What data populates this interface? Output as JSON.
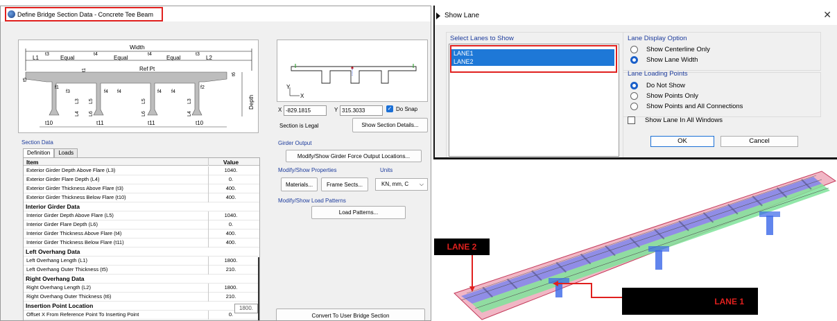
{
  "bridge_dialog": {
    "title": "Define Bridge Section Data - Concrete Tee Beam",
    "diagram": {
      "width": "Width",
      "l1": "L1",
      "l2": "L2",
      "t3a": "t3",
      "t3b": "t3",
      "t4a": "t4",
      "t4b": "t4",
      "equal1": "Equal",
      "equal2": "Equal",
      "equal3": "Equal",
      "t5": "t5",
      "t1": "t1",
      "t6": "t6",
      "ref_pt": "Ref Pt",
      "f1": "f1",
      "f2": "f2",
      "f3": "f3",
      "f4a": "f4",
      "f4b": "f4",
      "f4c": "f4",
      "f4d": "f4",
      "l3a": "L3",
      "l3b": "L3",
      "l4a": "L4",
      "l4b": "L4",
      "l5a": "L5",
      "l5b": "L5",
      "l6a": "L6",
      "l6b": "L6",
      "depth": "Depth",
      "t10a": "t10",
      "t10b": "t10",
      "t11a": "t11",
      "t11b": "t11"
    },
    "preview": {
      "axis_y": "Y",
      "axis_x": "X"
    },
    "coords": {
      "x_label": "X",
      "x_value": "-829.1815",
      "y_label": "Y",
      "y_value": "315.3033",
      "snap_label": "Do Snap"
    },
    "section_status": "Section is Legal",
    "show_details_button": "Show Section Details...",
    "section_data_label": "Section Data",
    "tabs": [
      "Definition",
      "Loads"
    ],
    "grid_headers": {
      "item": "Item",
      "value": "Value"
    },
    "rows": [
      {
        "item": "Exterior Girder Depth Above Flare (L3)",
        "value": "1040."
      },
      {
        "item": "Exterior Girder Flare Depth (L4)",
        "value": "0."
      },
      {
        "item": "Exterior Girder Thickness Above Flare (t3)",
        "value": "400."
      },
      {
        "item": "Exterior Girder Thickness Below Flare (t10)",
        "value": "400."
      },
      {
        "item": "Interior Girder Data",
        "value": ""
      },
      {
        "item": "Interior Girder Depth Above Flare (L5)",
        "value": "1040."
      },
      {
        "item": "Interior Girder Flare Depth (L6)",
        "value": "0."
      },
      {
        "item": "Interior Girder Thickness Above Flare (t4)",
        "value": "400."
      },
      {
        "item": "Interior Girder Thickness Below Flare (t11)",
        "value": "400."
      },
      {
        "item": "Left Overhang Data",
        "value": ""
      },
      {
        "item": "Left Overhang Length (L1)",
        "value": "1800."
      },
      {
        "item": "Left Overhang Outer Thickness (t5)",
        "value": "210."
      },
      {
        "item": "Right Overhang Data",
        "value": ""
      },
      {
        "item": "Right Overhang Length (L2)",
        "value": "1800."
      },
      {
        "item": "Right Overhang Outer Thickness (t6)",
        "value": "210."
      },
      {
        "item": "Insertion Point Location",
        "value": ""
      },
      {
        "item": "Offset X From Reference Point To Inserting Point",
        "value": "0."
      }
    ],
    "tooltip_value": "1800.",
    "girder_output": {
      "label": "Girder Output",
      "button": "Modify/Show Girder Force Output Locations..."
    },
    "properties": {
      "label": "Modify/Show Properties",
      "materials": "Materials...",
      "frame_sects": "Frame Sects..."
    },
    "units": {
      "label": "Units",
      "value": "KN, mm, C"
    },
    "load_patterns": {
      "label": "Modify/Show Load Patterns",
      "button": "Load Patterns..."
    },
    "convert_button": "Convert To User Bridge Section"
  },
  "lane_dialog": {
    "title": "Show Lane",
    "select_label": "Select Lanes to Show",
    "lanes": [
      "LANE1",
      "LANE2"
    ],
    "display_label": "Lane Display Option",
    "display_options": [
      {
        "label": "Show Centerline Only",
        "selected": false
      },
      {
        "label": "Show Lane Width",
        "selected": true
      }
    ],
    "loading_label": "Lane Loading Points",
    "loading_options": [
      {
        "label": "Do Not Show",
        "selected": true
      },
      {
        "label": "Show Points Only",
        "selected": false
      },
      {
        "label": "Show Points and All Connections",
        "selected": false
      }
    ],
    "show_all_windows": "Show Lane In All Windows",
    "ok": "OK",
    "cancel": "Cancel"
  },
  "view3d": {
    "lane2_tag": "LANE 2",
    "lane1_tag": "LANE 1",
    "colors": {
      "deck": "#e67a96",
      "lane2": "#6f7ff0",
      "lane1": "#7fe39a",
      "annotation": "#e0201e",
      "pier": "#3a66e8"
    }
  }
}
